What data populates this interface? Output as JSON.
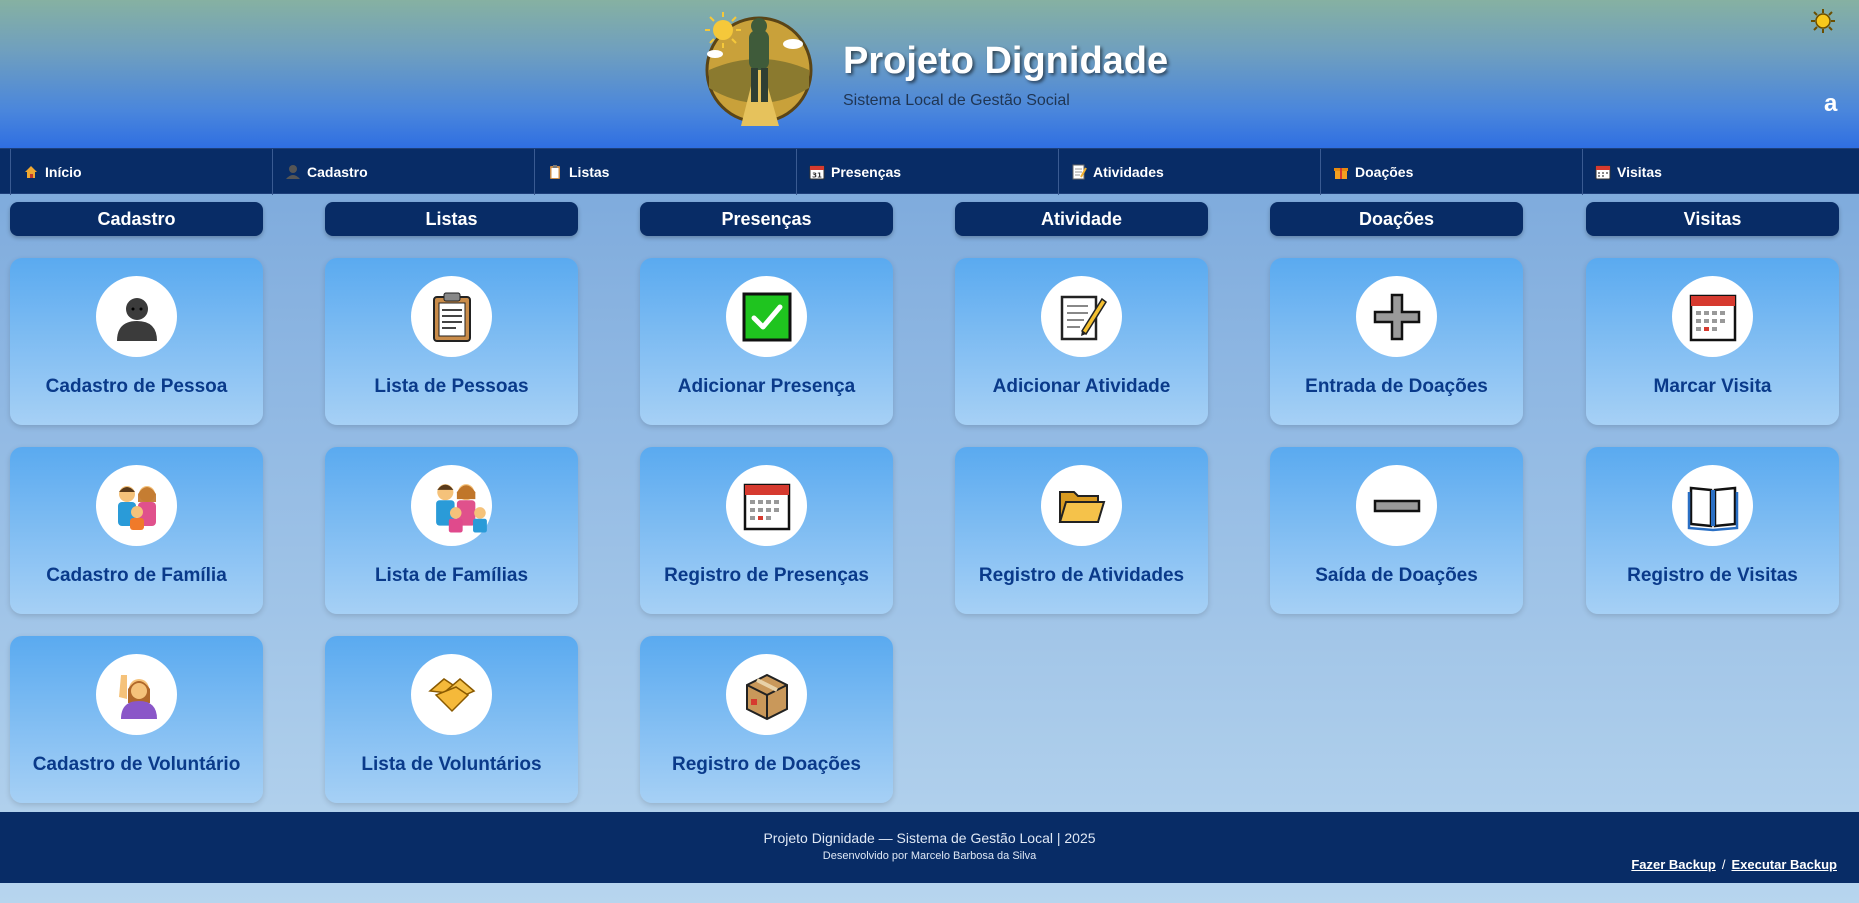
{
  "header": {
    "title": "Projeto Dignidade",
    "subtitle": "Sistema Local de Gestão Social",
    "corner_letter": "a",
    "theme_icon": "sun-icon"
  },
  "nav": {
    "items": [
      {
        "label": "Início",
        "icon": "house-icon"
      },
      {
        "label": "Cadastro",
        "icon": "person-icon"
      },
      {
        "label": "Listas",
        "icon": "clipboard-icon"
      },
      {
        "label": "Presenças",
        "icon": "calendar-icon"
      },
      {
        "label": "Atividades",
        "icon": "memo-icon"
      },
      {
        "label": "Doações",
        "icon": "gift-icon"
      },
      {
        "label": "Visitas",
        "icon": "calendar-icon"
      }
    ]
  },
  "columns": [
    {
      "title": "Cadastro",
      "cards": [
        {
          "label": "Cadastro de Pessoa",
          "icon": "person-icon"
        },
        {
          "label": "Cadastro de Família",
          "icon": "family-icon"
        },
        {
          "label": "Cadastro de Voluntário",
          "icon": "raising-hand-icon"
        }
      ]
    },
    {
      "title": "Listas",
      "cards": [
        {
          "label": "Lista de Pessoas",
          "icon": "clipboard-icon"
        },
        {
          "label": "Lista de Famílias",
          "icon": "family-group-icon"
        },
        {
          "label": "Lista de Voluntários",
          "icon": "handshake-icon"
        }
      ]
    },
    {
      "title": "Presenças",
      "cards": [
        {
          "label": "Adicionar Presença",
          "icon": "check-mark-icon"
        },
        {
          "label": "Registro de Presenças",
          "icon": "calendar-icon"
        },
        {
          "label": "Registro de Doações",
          "icon": "package-icon"
        }
      ]
    },
    {
      "title": "Atividade",
      "cards": [
        {
          "label": "Adicionar Atividade",
          "icon": "memo-icon"
        },
        {
          "label": "Registro de Atividades",
          "icon": "folder-icon"
        }
      ]
    },
    {
      "title": "Doações",
      "cards": [
        {
          "label": "Entrada de Doações",
          "icon": "plus-icon"
        },
        {
          "label": "Saída de Doações",
          "icon": "minus-icon"
        }
      ]
    },
    {
      "title": "Visitas",
      "cards": [
        {
          "label": "Marcar Visita",
          "icon": "calendar-icon"
        },
        {
          "label": "Registro de Visitas",
          "icon": "open-book-icon"
        }
      ]
    }
  ],
  "footer": {
    "main": "Projeto Dignidade — Sistema de Gestão Local | 2025",
    "credit": "Desenvolvido por Marcelo Barbosa da Silva",
    "backup_label": "Fazer Backup",
    "separator": "/",
    "restore_label": "Executar Backup"
  }
}
